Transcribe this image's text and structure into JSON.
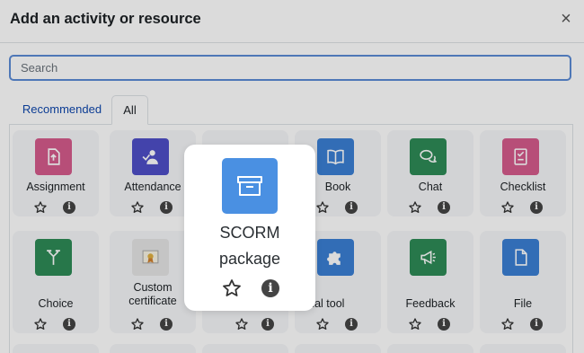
{
  "dialog": {
    "title": "Add an activity or resource",
    "close_glyph": "×"
  },
  "search": {
    "placeholder": "Search",
    "value": ""
  },
  "tabs": [
    {
      "label": "Recommended"
    },
    {
      "label": "All"
    }
  ],
  "tiles_row1": [
    {
      "label": "Assignment",
      "color": "#d65b8c",
      "icon": "assignment-icon"
    },
    {
      "label": "Attendance",
      "color": "#4e4fc7",
      "icon": "attendance-icon"
    },
    {
      "label": "",
      "color": "#f0f0f0",
      "icon": ""
    },
    {
      "label": "Book",
      "color": "#3b7fd4",
      "icon": "book-icon"
    },
    {
      "label": "Chat",
      "color": "#2e8b57",
      "icon": "chat-icon"
    },
    {
      "label": "Checklist",
      "color": "#d65b8c",
      "icon": "checklist-icon"
    }
  ],
  "tiles_row2": [
    {
      "label": "Choice",
      "color": "#2e8b57",
      "icon": "choice-icon"
    },
    {
      "label": "Custom certificate",
      "color": "#e8e8e8",
      "icon": "certificate-icon"
    },
    {
      "label": "",
      "color": "#f0f0f0",
      "icon": ""
    },
    {
      "label": "ternal tool",
      "color": "#3b7fd4",
      "icon": "puzzle-icon"
    },
    {
      "label": "Feedback",
      "color": "#2e8b57",
      "icon": "megaphone-icon"
    },
    {
      "label": "File",
      "color": "#3b7fd4",
      "icon": "file-icon"
    }
  ],
  "highlight": {
    "label_line1": "SCORM",
    "label_line2": "package",
    "color": "#4a90e2",
    "icon": "package-icon"
  },
  "info_glyph": "i"
}
